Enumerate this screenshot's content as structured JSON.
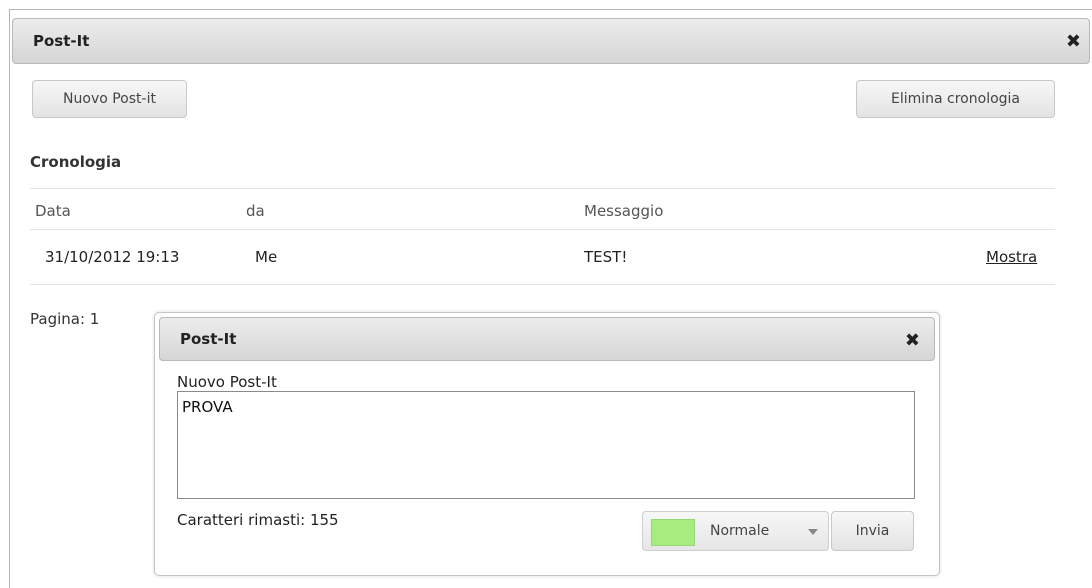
{
  "main_window": {
    "title": "Post-It",
    "close_glyph": "✖",
    "new_button": "Nuovo Post-it",
    "clear_button": "Elimina cronologia",
    "history_title": "Cronologia",
    "table": {
      "columns": [
        "Data",
        "da",
        "Messaggio"
      ],
      "rows": [
        {
          "date": "31/10/2012 19:13",
          "from": "Me",
          "message": "TEST!",
          "action": "Mostra"
        }
      ]
    },
    "pager": "Pagina: 1"
  },
  "dialog": {
    "title": "Post-It",
    "close_glyph": "✖",
    "field_label": "Nuovo Post-It",
    "text_value": "PROVA",
    "chars_left": "Caratteri rimasti: 155",
    "priority_select": {
      "selected": "Normale",
      "swatch_color": "#a6ec7e"
    },
    "send_button": "Invia"
  },
  "icons": {
    "close": "close-icon",
    "dropdown": "chevron-down-icon"
  }
}
